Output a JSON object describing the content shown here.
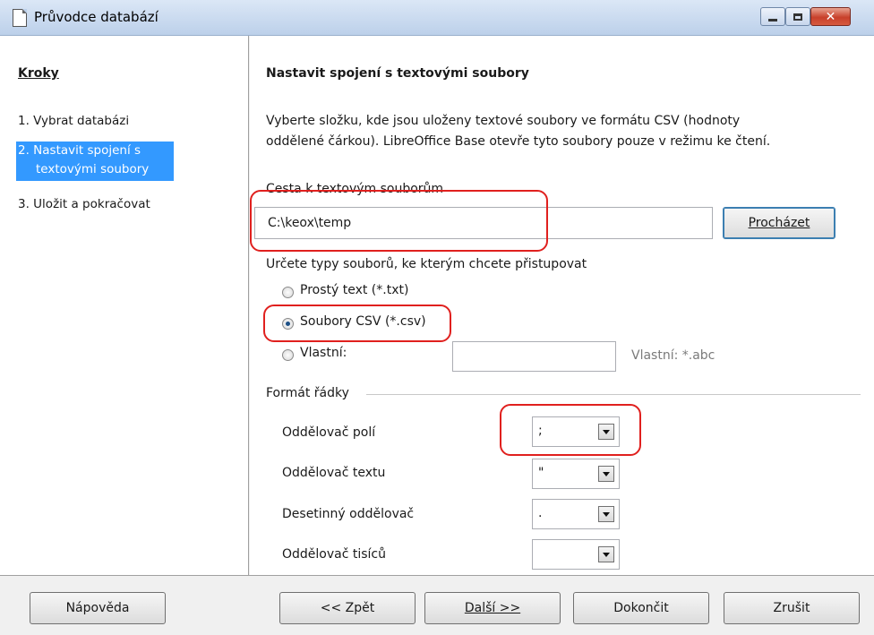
{
  "window": {
    "title": "Průvodce databází"
  },
  "steps": {
    "heading": "Kroky",
    "items": [
      {
        "label": "1. Vybrat databázi"
      },
      {
        "label_line1": "2. Nastavit spojení s",
        "label_line2": "textovými soubory"
      },
      {
        "label": "3. Uložit a pokračovat"
      }
    ]
  },
  "main": {
    "title": "Nastavit spojení s textovými soubory",
    "description_line1": "Vyberte složku, kde jsou uloženy textové soubory ve formátu CSV (hodnoty",
    "description_line2": "oddělené čárkou). LibreOffice Base otevře tyto soubory pouze v režimu ke čtení.",
    "path_label": "Cesta k textovým souborům",
    "path_value": "C:\\keox\\temp",
    "browse_label": "Procházet",
    "filetype_label": "Určete typy souborů, ke kterým chcete přistupovat",
    "filetypes": [
      {
        "label": "Prostý text (*.txt)",
        "checked": false
      },
      {
        "label": "Soubory CSV (*.csv)",
        "checked": true
      },
      {
        "label": "Vlastní:",
        "checked": false
      }
    ],
    "custom_value": "",
    "custom_hint": "Vlastní: *.abc",
    "row_format_label": "Formát řádky",
    "field_separator_label": "Oddělovač polí",
    "field_separator_value": ";",
    "text_separator_label": "Oddělovač textu",
    "text_separator_value": "\"",
    "decimal_separator_label": "Desetinný oddělovač",
    "decimal_separator_value": ".",
    "thousands_separator_label": "Oddělovač tisíců",
    "thousands_separator_value": ""
  },
  "footer": {
    "help": "Nápověda",
    "back": "<< Zpět",
    "next": "Další >>",
    "finish": "Dokončit",
    "cancel": "Zrušit"
  },
  "annotations": {
    "color": "#e0201e"
  }
}
